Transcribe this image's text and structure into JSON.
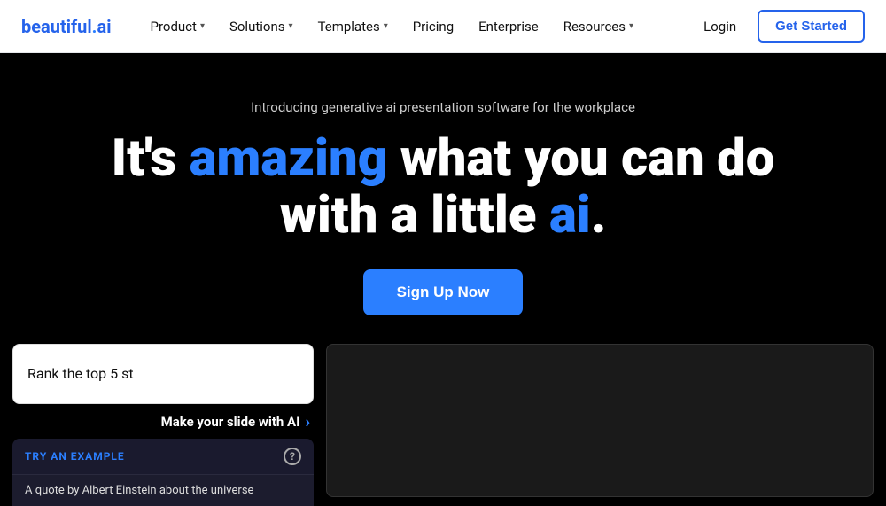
{
  "logo": {
    "text_before": "beautiful",
    "dot": ".",
    "text_after": "ai"
  },
  "nav": {
    "items": [
      {
        "label": "Product",
        "hasDropdown": true
      },
      {
        "label": "Solutions",
        "hasDropdown": true
      },
      {
        "label": "Templates",
        "hasDropdown": true
      },
      {
        "label": "Pricing",
        "hasDropdown": false
      },
      {
        "label": "Enterprise",
        "hasDropdown": false
      },
      {
        "label": "Resources",
        "hasDropdown": true
      }
    ],
    "login_label": "Login",
    "get_started_label": "Get Started"
  },
  "hero": {
    "subtitle": "Introducing generative ai presentation software for the workplace",
    "title_part1": "It's ",
    "title_accent1": "amazing",
    "title_part2": " what you can do",
    "title_part3": "with a little ",
    "title_accent2": "ai",
    "title_part4": ".",
    "cta_label": "Sign Up Now"
  },
  "bottom": {
    "ai_input_value": "Rank the top 5 st",
    "make_slide_label": "Make your slide with AI",
    "try_label": "TRY AN EXAMPLE",
    "help_icon_label": "?",
    "example_item": "A quote by Albert Einstein about the universe"
  }
}
